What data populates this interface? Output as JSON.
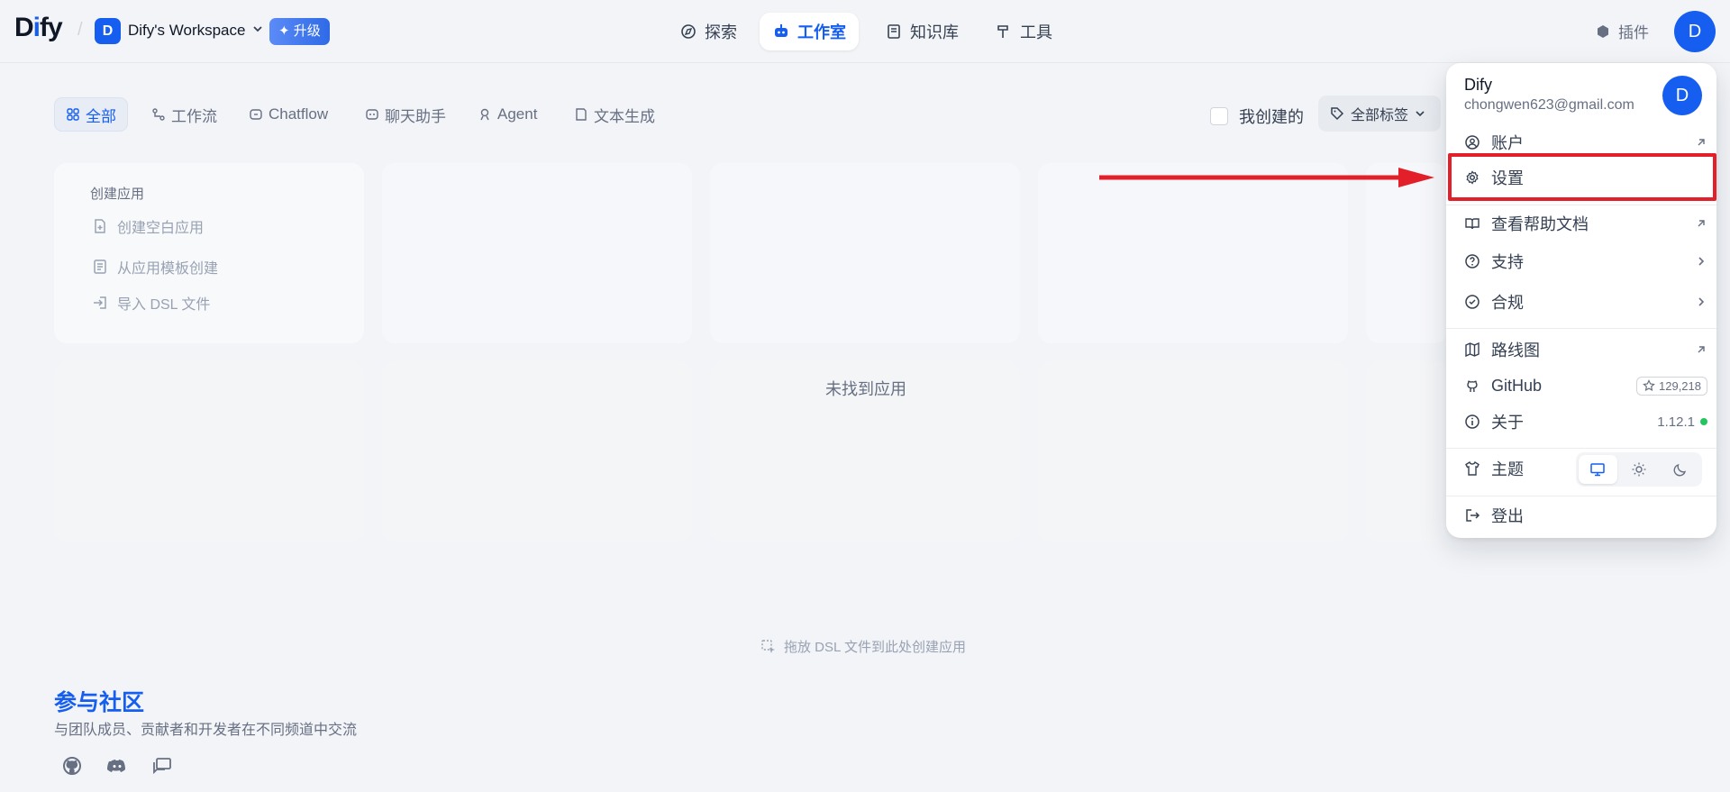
{
  "header": {
    "logo": "Dify",
    "workspace_initial": "D",
    "workspace_name": "Dify's Workspace",
    "upgrade_label": "升级",
    "nav": [
      {
        "label": "探索",
        "icon": "compass-icon",
        "active": false
      },
      {
        "label": "工作室",
        "icon": "robot-icon",
        "active": true
      },
      {
        "label": "知识库",
        "icon": "book-icon",
        "active": false
      },
      {
        "label": "工具",
        "icon": "hammer-icon",
        "active": false
      }
    ],
    "plugins_label": "插件",
    "avatar_initial": "D"
  },
  "filters": {
    "tabs": [
      {
        "label": "全部",
        "icon": "grid-icon",
        "active": true
      },
      {
        "label": "工作流",
        "icon": "workflow-icon",
        "active": false
      },
      {
        "label": "Chatflow",
        "icon": "chat-bubble-icon",
        "active": false
      },
      {
        "label": "聊天助手",
        "icon": "assistant-icon",
        "active": false
      },
      {
        "label": "Agent",
        "icon": "agent-icon",
        "active": false
      },
      {
        "label": "文本生成",
        "icon": "document-icon",
        "active": false
      }
    ],
    "mine_label": "我创建的",
    "tags_label": "全部标签"
  },
  "create_card": {
    "title": "创建应用",
    "items": [
      "创建空白应用",
      "从应用模板创建",
      "导入 DSL 文件"
    ]
  },
  "empty_message": "未找到应用",
  "drop_hint": "拖放 DSL 文件到此处创建应用",
  "community": {
    "title": "参与社区",
    "subtitle": "与团队成员、贡献者和开发者在不同频道中交流"
  },
  "menu": {
    "user_name": "Dify",
    "email": "chongwen623@gmail.com",
    "avatar_initial": "D",
    "items": {
      "account": "账户",
      "settings": "设置",
      "docs": "查看帮助文档",
      "support": "支持",
      "compliance": "合规",
      "roadmap": "路线图",
      "github": "GitHub",
      "github_stars": "129,218",
      "about": "关于",
      "version": "1.12.1",
      "theme": "主题",
      "logout": "登出"
    }
  },
  "colors": {
    "accent": "#155eef",
    "highlight": "#e3202a",
    "status_ok": "#22c55e"
  }
}
